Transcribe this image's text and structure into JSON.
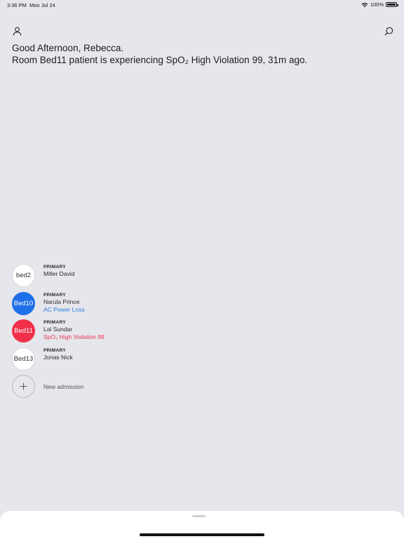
{
  "status_bar": {
    "time": "3:36 PM",
    "date": "Mon Jul 24",
    "battery_text": "100%",
    "battery_level": 1.0
  },
  "header": {
    "profile_icon": "person-icon",
    "search_icon": "search-icon"
  },
  "greeting": {
    "line1": "Good Afternoon, Rebecca.",
    "line2": "Room Bed11 patient is experiencing SpO₂ High Violation 99, 31m ago."
  },
  "beds": [
    {
      "bed": "bed2",
      "role": "PRIMARY",
      "name": "Miller David",
      "alert": "",
      "avatar_color": "#ffffff",
      "alert_color": ""
    },
    {
      "bed": "Bed10",
      "role": "PRIMARY",
      "name": "Narula Prince",
      "alert": "AC Power Loss",
      "avatar_color": "#1f6fe8",
      "alert_color": "#2f7de1"
    },
    {
      "bed": "Bed11",
      "role": "PRIMARY",
      "name": "Lal Sundar",
      "alert": "SpO₂ High Violation 99",
      "avatar_color": "#f0304b",
      "alert_color": "#e8364f"
    },
    {
      "bed": "Bed13",
      "role": "PRIMARY",
      "name": "Jonas Nick",
      "alert": "",
      "avatar_color": "#ffffff",
      "alert_color": ""
    }
  ],
  "new_admission": {
    "icon": "plus-icon",
    "label": "New admission"
  }
}
